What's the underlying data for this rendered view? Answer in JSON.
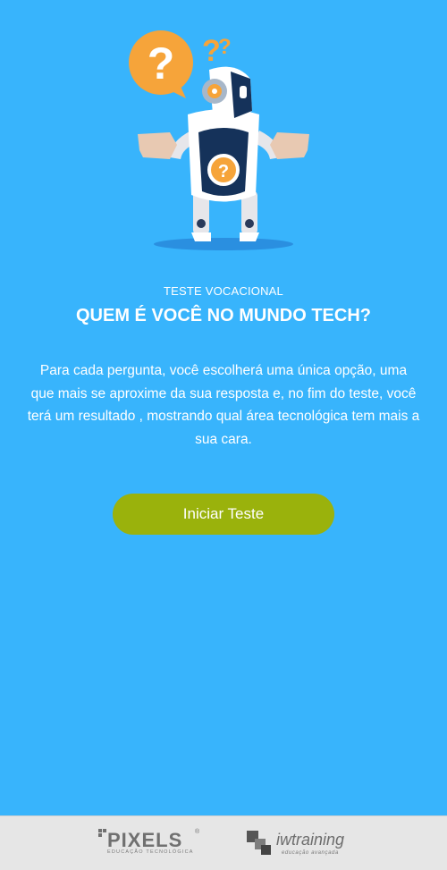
{
  "header": {
    "subtitle": "TESTE VOCACIONAL",
    "title": "QUEM É VOCÊ NO MUNDO TECH?"
  },
  "intro": {
    "description": "Para cada pergunta, você escolherá uma única opção, uma que mais se aproxime da sua resposta e, no fim do teste, você terá um resultado , mostrando qual área tecnológica tem mais a sua cara."
  },
  "actions": {
    "start_label": "Iniciar Teste"
  },
  "footer": {
    "logos": [
      {
        "name": "PIXELS",
        "tagline": "EDUCAÇÃO TECNOLÓGICA",
        "mark": "®"
      },
      {
        "name": "iwtraining",
        "tagline": "educação avançada"
      }
    ]
  },
  "colors": {
    "background": "#38b4fc",
    "button": "#9ab20c",
    "footer": "#e6e6e6",
    "speech_bubble": "#f6a43a"
  },
  "icons": {
    "hero": "robot-question-illustration",
    "bubble": "question-speech-bubble-icon"
  }
}
